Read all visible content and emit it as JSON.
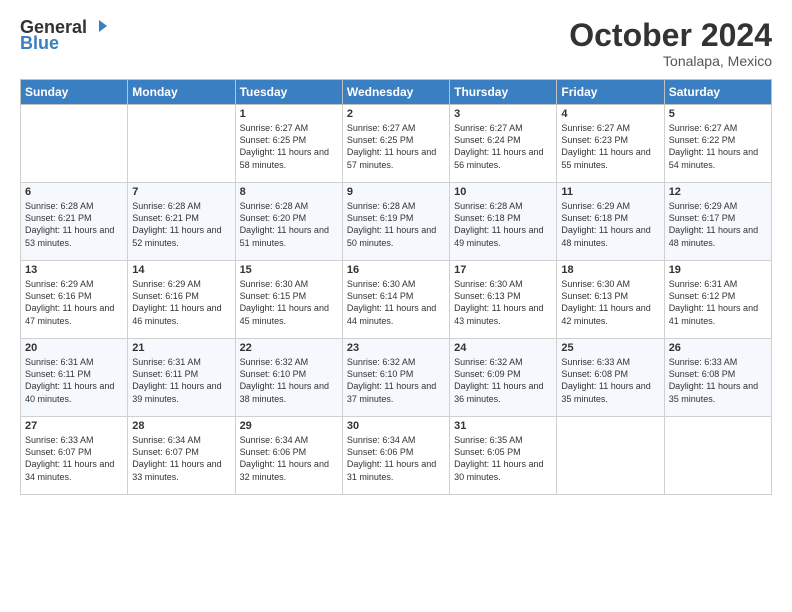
{
  "header": {
    "logo_general": "General",
    "logo_blue": "Blue",
    "month": "October 2024",
    "location": "Tonalapa, Mexico"
  },
  "days_of_week": [
    "Sunday",
    "Monday",
    "Tuesday",
    "Wednesday",
    "Thursday",
    "Friday",
    "Saturday"
  ],
  "weeks": [
    [
      {
        "day": "",
        "sunrise": "",
        "sunset": "",
        "daylight": ""
      },
      {
        "day": "",
        "sunrise": "",
        "sunset": "",
        "daylight": ""
      },
      {
        "day": "1",
        "sunrise": "Sunrise: 6:27 AM",
        "sunset": "Sunset: 6:25 PM",
        "daylight": "Daylight: 11 hours and 58 minutes."
      },
      {
        "day": "2",
        "sunrise": "Sunrise: 6:27 AM",
        "sunset": "Sunset: 6:25 PM",
        "daylight": "Daylight: 11 hours and 57 minutes."
      },
      {
        "day": "3",
        "sunrise": "Sunrise: 6:27 AM",
        "sunset": "Sunset: 6:24 PM",
        "daylight": "Daylight: 11 hours and 56 minutes."
      },
      {
        "day": "4",
        "sunrise": "Sunrise: 6:27 AM",
        "sunset": "Sunset: 6:23 PM",
        "daylight": "Daylight: 11 hours and 55 minutes."
      },
      {
        "day": "5",
        "sunrise": "Sunrise: 6:27 AM",
        "sunset": "Sunset: 6:22 PM",
        "daylight": "Daylight: 11 hours and 54 minutes."
      }
    ],
    [
      {
        "day": "6",
        "sunrise": "Sunrise: 6:28 AM",
        "sunset": "Sunset: 6:21 PM",
        "daylight": "Daylight: 11 hours and 53 minutes."
      },
      {
        "day": "7",
        "sunrise": "Sunrise: 6:28 AM",
        "sunset": "Sunset: 6:21 PM",
        "daylight": "Daylight: 11 hours and 52 minutes."
      },
      {
        "day": "8",
        "sunrise": "Sunrise: 6:28 AM",
        "sunset": "Sunset: 6:20 PM",
        "daylight": "Daylight: 11 hours and 51 minutes."
      },
      {
        "day": "9",
        "sunrise": "Sunrise: 6:28 AM",
        "sunset": "Sunset: 6:19 PM",
        "daylight": "Daylight: 11 hours and 50 minutes."
      },
      {
        "day": "10",
        "sunrise": "Sunrise: 6:28 AM",
        "sunset": "Sunset: 6:18 PM",
        "daylight": "Daylight: 11 hours and 49 minutes."
      },
      {
        "day": "11",
        "sunrise": "Sunrise: 6:29 AM",
        "sunset": "Sunset: 6:18 PM",
        "daylight": "Daylight: 11 hours and 48 minutes."
      },
      {
        "day": "12",
        "sunrise": "Sunrise: 6:29 AM",
        "sunset": "Sunset: 6:17 PM",
        "daylight": "Daylight: 11 hours and 48 minutes."
      }
    ],
    [
      {
        "day": "13",
        "sunrise": "Sunrise: 6:29 AM",
        "sunset": "Sunset: 6:16 PM",
        "daylight": "Daylight: 11 hours and 47 minutes."
      },
      {
        "day": "14",
        "sunrise": "Sunrise: 6:29 AM",
        "sunset": "Sunset: 6:16 PM",
        "daylight": "Daylight: 11 hours and 46 minutes."
      },
      {
        "day": "15",
        "sunrise": "Sunrise: 6:30 AM",
        "sunset": "Sunset: 6:15 PM",
        "daylight": "Daylight: 11 hours and 45 minutes."
      },
      {
        "day": "16",
        "sunrise": "Sunrise: 6:30 AM",
        "sunset": "Sunset: 6:14 PM",
        "daylight": "Daylight: 11 hours and 44 minutes."
      },
      {
        "day": "17",
        "sunrise": "Sunrise: 6:30 AM",
        "sunset": "Sunset: 6:13 PM",
        "daylight": "Daylight: 11 hours and 43 minutes."
      },
      {
        "day": "18",
        "sunrise": "Sunrise: 6:30 AM",
        "sunset": "Sunset: 6:13 PM",
        "daylight": "Daylight: 11 hours and 42 minutes."
      },
      {
        "day": "19",
        "sunrise": "Sunrise: 6:31 AM",
        "sunset": "Sunset: 6:12 PM",
        "daylight": "Daylight: 11 hours and 41 minutes."
      }
    ],
    [
      {
        "day": "20",
        "sunrise": "Sunrise: 6:31 AM",
        "sunset": "Sunset: 6:11 PM",
        "daylight": "Daylight: 11 hours and 40 minutes."
      },
      {
        "day": "21",
        "sunrise": "Sunrise: 6:31 AM",
        "sunset": "Sunset: 6:11 PM",
        "daylight": "Daylight: 11 hours and 39 minutes."
      },
      {
        "day": "22",
        "sunrise": "Sunrise: 6:32 AM",
        "sunset": "Sunset: 6:10 PM",
        "daylight": "Daylight: 11 hours and 38 minutes."
      },
      {
        "day": "23",
        "sunrise": "Sunrise: 6:32 AM",
        "sunset": "Sunset: 6:10 PM",
        "daylight": "Daylight: 11 hours and 37 minutes."
      },
      {
        "day": "24",
        "sunrise": "Sunrise: 6:32 AM",
        "sunset": "Sunset: 6:09 PM",
        "daylight": "Daylight: 11 hours and 36 minutes."
      },
      {
        "day": "25",
        "sunrise": "Sunrise: 6:33 AM",
        "sunset": "Sunset: 6:08 PM",
        "daylight": "Daylight: 11 hours and 35 minutes."
      },
      {
        "day": "26",
        "sunrise": "Sunrise: 6:33 AM",
        "sunset": "Sunset: 6:08 PM",
        "daylight": "Daylight: 11 hours and 35 minutes."
      }
    ],
    [
      {
        "day": "27",
        "sunrise": "Sunrise: 6:33 AM",
        "sunset": "Sunset: 6:07 PM",
        "daylight": "Daylight: 11 hours and 34 minutes."
      },
      {
        "day": "28",
        "sunrise": "Sunrise: 6:34 AM",
        "sunset": "Sunset: 6:07 PM",
        "daylight": "Daylight: 11 hours and 33 minutes."
      },
      {
        "day": "29",
        "sunrise": "Sunrise: 6:34 AM",
        "sunset": "Sunset: 6:06 PM",
        "daylight": "Daylight: 11 hours and 32 minutes."
      },
      {
        "day": "30",
        "sunrise": "Sunrise: 6:34 AM",
        "sunset": "Sunset: 6:06 PM",
        "daylight": "Daylight: 11 hours and 31 minutes."
      },
      {
        "day": "31",
        "sunrise": "Sunrise: 6:35 AM",
        "sunset": "Sunset: 6:05 PM",
        "daylight": "Daylight: 11 hours and 30 minutes."
      },
      {
        "day": "",
        "sunrise": "",
        "sunset": "",
        "daylight": ""
      },
      {
        "day": "",
        "sunrise": "",
        "sunset": "",
        "daylight": ""
      }
    ]
  ]
}
